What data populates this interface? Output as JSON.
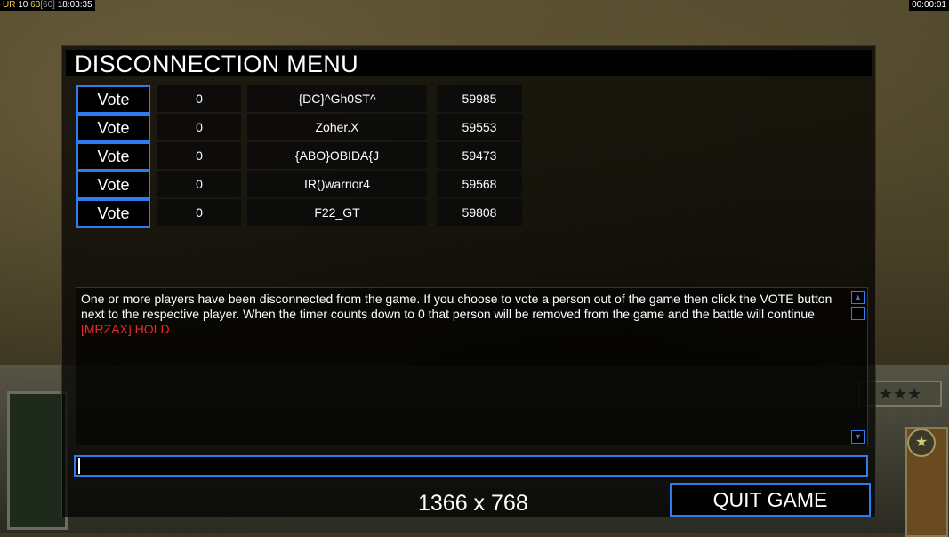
{
  "top_left_status": {
    "a": "UR",
    "b": "10",
    "c": "63",
    "d": "[60]",
    "time": "18:03:35"
  },
  "top_right_status": {
    "timer": "00:00:01"
  },
  "dialog": {
    "title": "DISCONNECTION MENU",
    "rows": [
      {
        "vote_label": "Vote",
        "count": "0",
        "player": "{DC}^Gh0ST^",
        "ping": "59985"
      },
      {
        "vote_label": "Vote",
        "count": "0",
        "player": "Zoher.X",
        "ping": "59553"
      },
      {
        "vote_label": "Vote",
        "count": "0",
        "player": "{ABO}OBIDA{J",
        "ping": "59473"
      },
      {
        "vote_label": "Vote",
        "count": "0",
        "player": "IR()warrior4",
        "ping": "59568"
      },
      {
        "vote_label": "Vote",
        "count": "0",
        "player": "F22_GT",
        "ping": "59808"
      }
    ],
    "message": "One or more players have been disconnected from the game. If you choose to vote a person out of the game then click the VOTE button next to the respective player. When the timer counts down to 0 that person will be removed from the game and the battle will continue",
    "chat_line": "[MRZAX] HOLD",
    "chat_input_value": "",
    "resolution": "1366 x 768",
    "quit_label": "QUIT GAME"
  },
  "colors": {
    "border_accent": "#2f7cf0",
    "chat_red": "#e82a2a",
    "status_yellow": "#f5d142"
  },
  "icons": {
    "scroll_up": "scroll-up-arrow-icon",
    "scroll_down": "scroll-down-arrow-icon",
    "hud_star": "star-badge-icon"
  }
}
